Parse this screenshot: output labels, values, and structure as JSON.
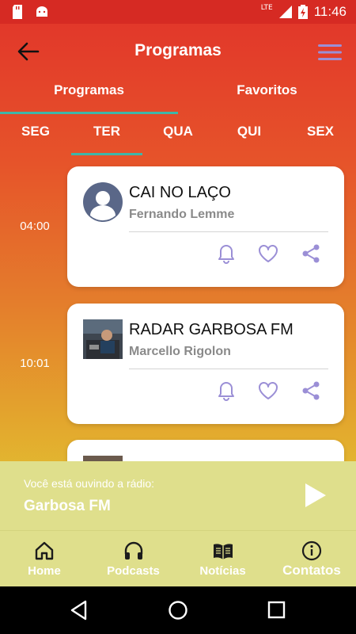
{
  "status_bar": {
    "time": "11:46",
    "network": "LTE"
  },
  "header": {
    "title": "Programas"
  },
  "tabs": [
    {
      "label": "Programas"
    },
    {
      "label": "Favoritos"
    }
  ],
  "days": [
    "SEG",
    "TER",
    "QUA",
    "QUI",
    "SEX"
  ],
  "selected_day": "TER",
  "programs": [
    {
      "time": "04:00",
      "name": "CAI NO LAÇO",
      "host": "Fernando Lemme"
    },
    {
      "time": "10:01",
      "name": "RADAR GARBOSA FM",
      "host": "Marcello Rigolon"
    }
  ],
  "player": {
    "pre_text": "Você está ouvindo a rádio:",
    "station": "Garbosa FM"
  },
  "bottom_nav": [
    {
      "label": "Home",
      "icon": "home-icon"
    },
    {
      "label": "Podcasts",
      "icon": "headphones-icon"
    },
    {
      "label": "Notícias",
      "icon": "book-icon"
    },
    {
      "label": "Contatos",
      "icon": "info-icon"
    }
  ],
  "colors": {
    "accent": "#3fb6a8",
    "action_icon": "#9b8fd6",
    "player_bg": "#dfdf8c",
    "header_red": "#e2382a"
  }
}
